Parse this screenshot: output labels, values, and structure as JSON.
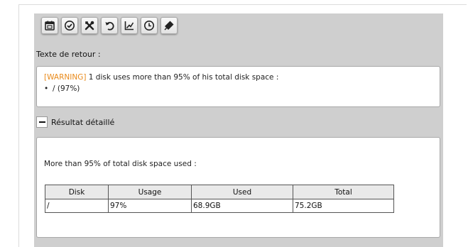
{
  "toolbar": {
    "buttons": [
      {
        "name": "calendar-icon",
        "tooltip": ""
      },
      {
        "name": "check-circle-icon",
        "tooltip": ""
      },
      {
        "name": "tools-icon",
        "tooltip": ""
      },
      {
        "name": "undo-icon",
        "tooltip": ""
      },
      {
        "name": "chart-icon",
        "tooltip": ""
      },
      {
        "name": "clock-icon",
        "tooltip": ""
      },
      {
        "name": "pin-icon",
        "tooltip": ""
      }
    ]
  },
  "return_text": {
    "label": "Texte de retour :",
    "status_tag": "[WARNING]",
    "message": " 1 disk uses more than 95% of his total disk space :",
    "bullet": "/ (97%)"
  },
  "details": {
    "toggle_symbol": "−",
    "label": "Résultat détaillé",
    "title": "More than 95% of total disk space used :",
    "table": {
      "headers": [
        "Disk",
        "Usage",
        "Used",
        "Total"
      ],
      "rows": [
        [
          "/",
          "97%",
          "68.9GB",
          "75.2GB"
        ]
      ]
    }
  },
  "colors": {
    "warning": "#e98a1a",
    "panel_bg": "#cfcfcf",
    "header_bg": "#e9e9e9"
  }
}
